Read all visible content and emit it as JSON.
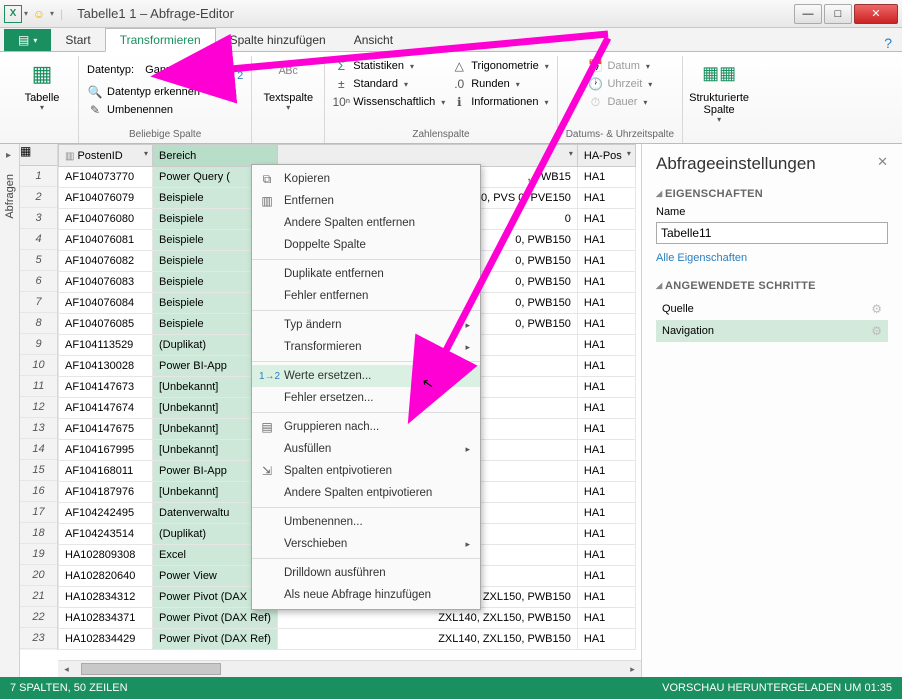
{
  "window": {
    "title": "Tabelle1 1 – Abfrage-Editor"
  },
  "tabs": {
    "file": "",
    "t0": "Start",
    "t1": "Transformieren",
    "t2": "Spalte hinzufügen",
    "t3": "Ansicht"
  },
  "ribbon": {
    "group0_btn": "Tabelle",
    "group1": {
      "r0a": "Datentyp:",
      "r0b": "Ganze Zahl",
      "r1": "Datentyp erkennen",
      "r2": "Umbenennen",
      "r0c_icon": "1₂",
      "label": "Beliebige Spalte"
    },
    "group2_btn": "Textspalte",
    "group3": {
      "r0": "Statistiken",
      "r1": "Standard",
      "r2": "Wissenschaftlich",
      "c0": "Trigonometrie",
      "c1": "Runden",
      "c2": "Informationen",
      "label": "Zahlenspalte"
    },
    "group4": {
      "r0": "Datum",
      "r1": "Uhrzeit",
      "r2": "Dauer",
      "label": "Datums- & Uhrzeitspalte"
    },
    "group5_btn": "Strukturierte\nSpalte"
  },
  "left_rail": "Abfragen",
  "columns": {
    "c0": "PostenID",
    "c1": "Bereich",
    "c2_hidden": "",
    "c3": "HA-Pos"
  },
  "rows": [
    {
      "n": "1",
      "id": "AF104073770",
      "ber": "Power Query (",
      "mid": ", PWB15",
      "ha": "HA1"
    },
    {
      "n": "2",
      "id": "AF104076079",
      "ber": "Beispiele",
      "mid": "0, PVS    0, PVE150",
      "ha": "HA1"
    },
    {
      "n": "3",
      "id": "AF104076080",
      "ber": "Beispiele",
      "mid": "0",
      "ha": "HA1"
    },
    {
      "n": "4",
      "id": "AF104076081",
      "ber": "Beispiele",
      "mid": "0, PWB150",
      "ha": "HA1"
    },
    {
      "n": "5",
      "id": "AF104076082",
      "ber": "Beispiele",
      "mid": "0, PWB150",
      "ha": "HA1"
    },
    {
      "n": "6",
      "id": "AF104076083",
      "ber": "Beispiele",
      "mid": "0, PWB150",
      "ha": "HA1"
    },
    {
      "n": "7",
      "id": "AF104076084",
      "ber": "Beispiele",
      "mid": "0, PWB150",
      "ha": "HA1"
    },
    {
      "n": "8",
      "id": "AF104076085",
      "ber": "Beispiele",
      "mid": "0, PWB150",
      "ha": "HA1"
    },
    {
      "n": "9",
      "id": "AF104113529",
      "ber": "(Duplikat)",
      "mid": "",
      "ha": "HA1"
    },
    {
      "n": "10",
      "id": "AF104130028",
      "ber": "Power BI-App",
      "mid": "",
      "ha": "HA1"
    },
    {
      "n": "11",
      "id": "AF104147673",
      "ber": "[Unbekannt]",
      "mid": "",
      "ha": "HA1"
    },
    {
      "n": "12",
      "id": "AF104147674",
      "ber": "[Unbekannt]",
      "mid": "",
      "ha": "HA1"
    },
    {
      "n": "13",
      "id": "AF104147675",
      "ber": "[Unbekannt]",
      "mid": "",
      "ha": "HA1"
    },
    {
      "n": "14",
      "id": "AF104167995",
      "ber": "[Unbekannt]",
      "mid": "",
      "ha": "HA1"
    },
    {
      "n": "15",
      "id": "AF104168011",
      "ber": "Power BI-App",
      "mid": "",
      "ha": "HA1"
    },
    {
      "n": "16",
      "id": "AF104187976",
      "ber": "[Unbekannt]",
      "mid": "",
      "ha": "HA1"
    },
    {
      "n": "17",
      "id": "AF104242495",
      "ber": "Datenverwaltu",
      "mid": "",
      "ha": "HA1"
    },
    {
      "n": "18",
      "id": "AF104243514",
      "ber": "(Duplikat)",
      "mid": "",
      "ha": "HA1"
    },
    {
      "n": "19",
      "id": "HA102809308",
      "ber": "Excel",
      "mid": "",
      "ha": "HA1"
    },
    {
      "n": "20",
      "id": "HA102820640",
      "ber": "Power View",
      "mid": "",
      "ha": "HA1"
    },
    {
      "n": "21",
      "id": "HA102834312",
      "ber": "Power Pivot (DAX Ref)",
      "mid": "ZXL140, ZXL150, PWB150",
      "ha": "HA1"
    },
    {
      "n": "22",
      "id": "HA102834371",
      "ber": "Power Pivot (DAX Ref)",
      "mid": "ZXL140, ZXL150, PWB150",
      "ha": "HA1"
    },
    {
      "n": "23",
      "id": "HA102834429",
      "ber": "Power Pivot (DAX Ref)",
      "mid": "ZXL140, ZXL150, PWB150",
      "ha": "HA1"
    }
  ],
  "context_menu": {
    "m0": "Kopieren",
    "m1": "Entfernen",
    "m2": "Andere Spalten entfernen",
    "m3": "Doppelte Spalte",
    "m4": "Duplikate entfernen",
    "m5": "Fehler entfernen",
    "m6": "Typ ändern",
    "m7": "Transformieren",
    "m8": "Werte ersetzen...",
    "m9": "Fehler ersetzen...",
    "m10": "Gruppieren nach...",
    "m11": "Ausfüllen",
    "m12": "Spalten entpivotieren",
    "m13": "Andere Spalten entpivotieren",
    "m14": "Umbenennen...",
    "m15": "Verschieben",
    "m16": "Drilldown ausführen",
    "m17": "Als neue Abfrage hinzufügen"
  },
  "right": {
    "title": "Abfrageeinstellungen",
    "sect1": "EIGENSCHAFTEN",
    "name_label": "Name",
    "name_value": "Tabelle11",
    "all_props": "Alle Eigenschaften",
    "sect2": "ANGEWENDETE SCHRITTE",
    "step0": "Quelle",
    "step1": "Navigation"
  },
  "status": {
    "left": "7 SPALTEN, 50 ZEILEN",
    "right": "VORSCHAU HERUNTERGELADEN UM 01:35"
  }
}
